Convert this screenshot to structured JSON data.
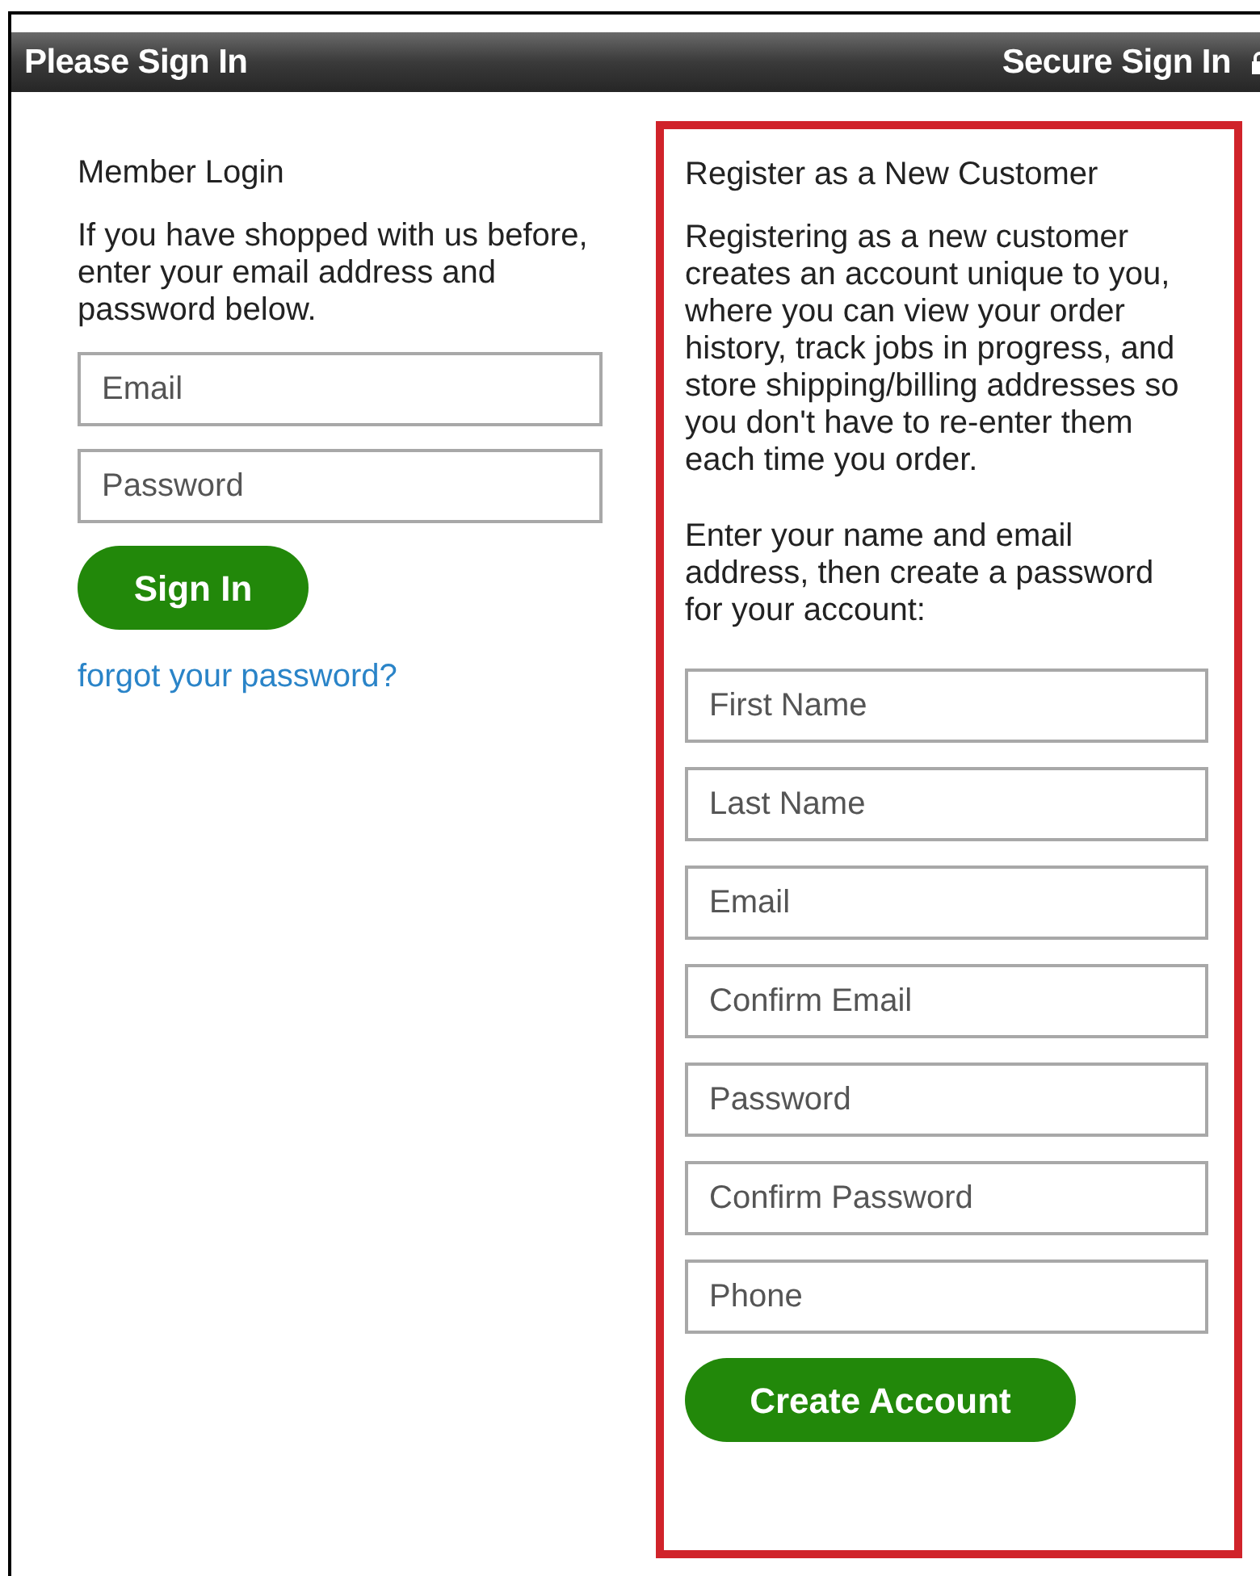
{
  "header": {
    "title": "Please Sign In",
    "secure_label": "Secure Sign In"
  },
  "login": {
    "heading": "Member Login",
    "intro": "If you have shopped with us before, enter your email address and password below.",
    "fields": [
      {
        "placeholder": "Email"
      },
      {
        "placeholder": "Password"
      }
    ],
    "button": "Sign In",
    "forgot_link": "forgot your password?"
  },
  "register": {
    "heading": "Register as a New Customer",
    "paragraphs": [
      "Registering as a new customer creates an account unique to you, where you can view your order history, track jobs in progress, and store shipping/billing addresses so you don't have to re-enter them each time you order.",
      "Enter your name and email address, then create a password for your account:"
    ],
    "fields": [
      {
        "placeholder": "First Name"
      },
      {
        "placeholder": "Last Name"
      },
      {
        "placeholder": "Email"
      },
      {
        "placeholder": "Confirm Email"
      },
      {
        "placeholder": "Password"
      },
      {
        "placeholder": "Confirm Password"
      },
      {
        "placeholder": "Phone"
      }
    ],
    "button": "Create Account"
  }
}
